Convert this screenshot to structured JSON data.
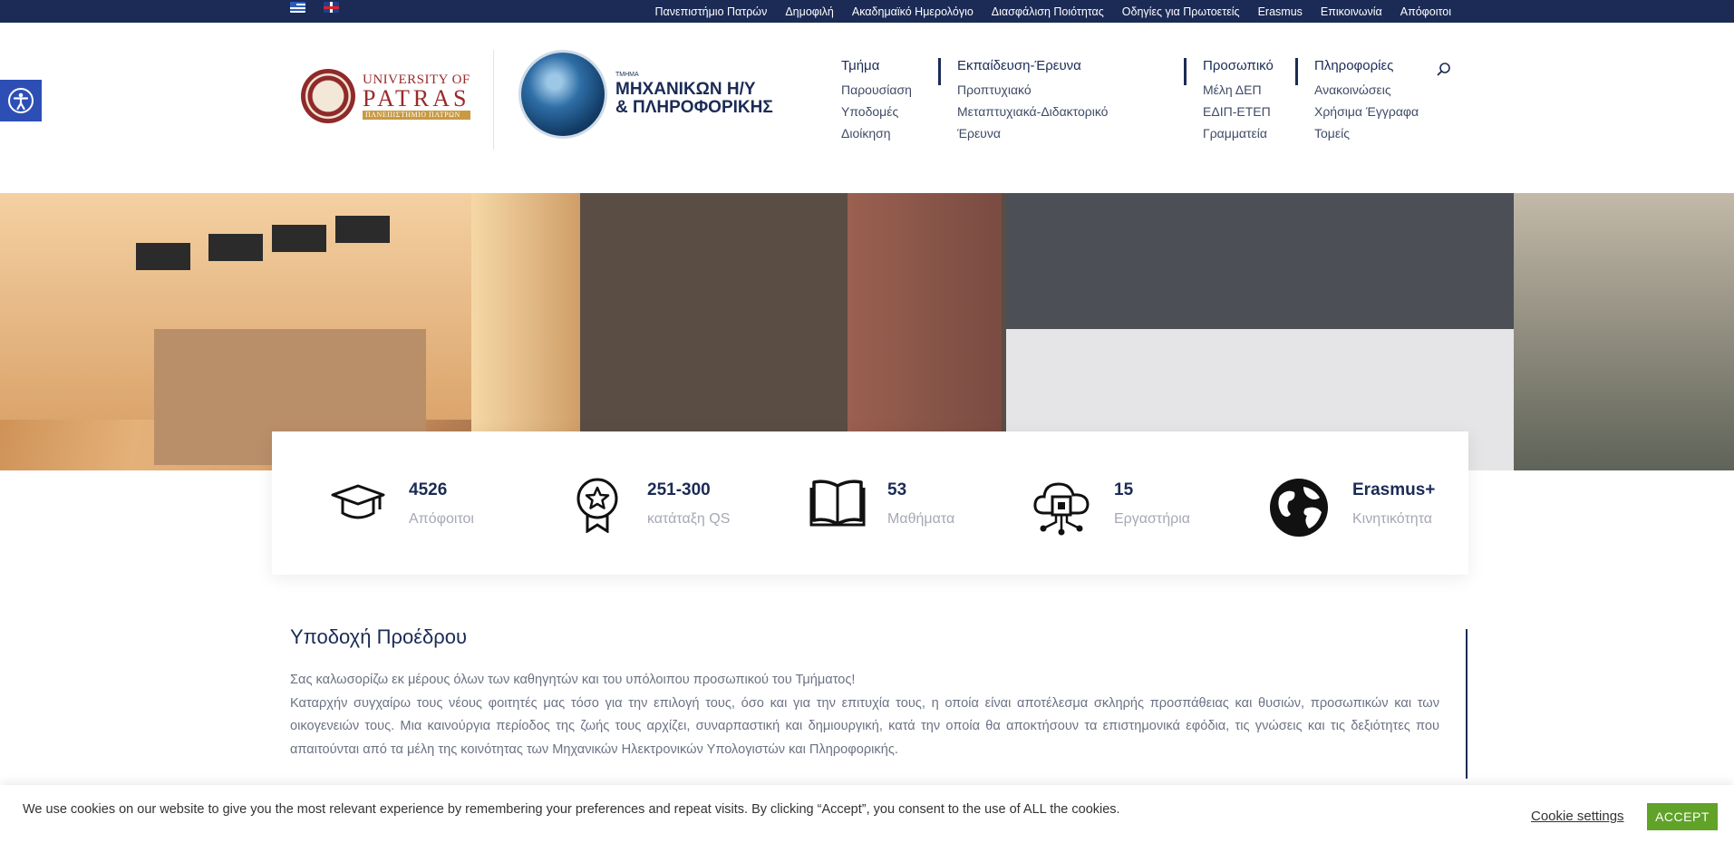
{
  "topbar": {
    "flags": [
      "greek-flag-icon",
      "uk-flag-icon"
    ],
    "links": [
      "Πανεπιστήμιο Πατρών",
      "Δημοφιλή",
      "Ακαδημαϊκό Ημερολόγιο",
      "Διασφάλιση Ποιότητας",
      "Οδηγίες για Πρωτοετείς",
      "Erasmus",
      "Επικοινωνία",
      "Απόφοιτοι"
    ]
  },
  "logos": {
    "university": {
      "line1": "UNIVERSITY OF",
      "line2": "PATRAS",
      "line3": "ΠΑΝΕΠΙΣΤΗΜΙΟ ΠΑΤΡΩΝ"
    },
    "department": {
      "small": "ΤΜΗΜΑ",
      "line1": "ΜΗΧΑΝΙΚΩΝ Η/Υ",
      "line2": "& ΠΛΗΡΟΦΟΡΙΚΗΣ"
    }
  },
  "nav": [
    {
      "head": "Τμήμα",
      "items": [
        "Παρουσίαση",
        "Υποδομές",
        "Διοίκηση"
      ]
    },
    {
      "head": "Εκπαίδευση-Έρευνα",
      "items": [
        "Προπτυχιακό",
        "Μεταπτυχιακά-Διδακτορικό",
        "Έρευνα"
      ]
    },
    {
      "head": "Προσωπικό",
      "items": [
        "Μέλη ΔΕΠ",
        "ΕΔΙΠ-ΕΤΕΠ",
        "Γραμματεία"
      ]
    },
    {
      "head": "Πληροφορίες",
      "items": [
        "Ανακοινώσεις",
        "Χρήσιμα Έγγραφα",
        "Τομείς"
      ]
    }
  ],
  "stats": [
    {
      "icon": "graduation-cap-icon",
      "value": "4526",
      "label": "Απόφοιτοι"
    },
    {
      "icon": "award-badge-icon",
      "value": "251-300",
      "label": "κατάταξη QS"
    },
    {
      "icon": "open-book-icon",
      "value": "53",
      "label": "Μαθήματα"
    },
    {
      "icon": "cloud-chip-icon",
      "value": "15",
      "label": "Εργαστήρια"
    },
    {
      "icon": "globe-icon",
      "value": "Erasmus+",
      "label": "Κινητικότητα"
    }
  ],
  "welcome": {
    "title": "Υποδοχή Προέδρου",
    "p1": "Σας καλωσορίζω εκ μέρους όλων των καθηγητών και του υπόλοιπου προσωπικού του Τμήματος!",
    "p2": "Καταρχήν συγχαίρω τους νέους φοιτητές μας τόσο για την επιλογή τους, όσο και για την επιτυχία τους, η οποία είναι αποτέλεσμα σκληρής προσπάθειας και θυσιών, προσωπικών και των οικογενειών τους. Μια καινούργια περίοδος της ζωής τους αρχίζει, συναρπαστική και δημιουργική, κατά την οποία θα αποκτήσουν τα επιστημονικά εφόδια, τις γνώσεις και τις δεξιότητες που απαιτούνται από τα μέλη της κοινότητας των Μηχανικών Ηλεκτρονικών Υπολογιστών και Πληροφορικής."
  },
  "cookie": {
    "text": "We use cookies on our website to give you the most relevant experience by remembering your preferences and repeat visits. By clicking “Accept”, you consent to the use of ALL the cookies.",
    "settings": "Cookie settings",
    "accept": "ACCEPT"
  },
  "colors": {
    "navy": "#1b2b55",
    "access": "#2d4fb5",
    "accept": "#61a229"
  }
}
